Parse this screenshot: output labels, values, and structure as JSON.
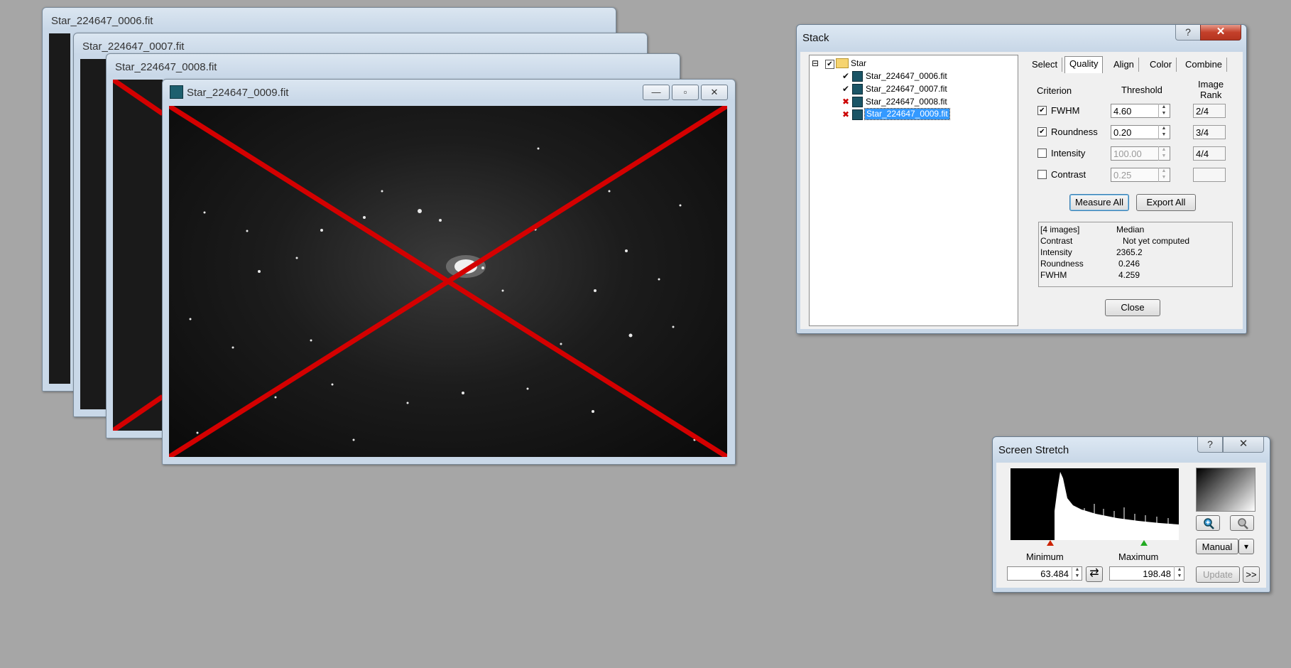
{
  "image_windows": [
    {
      "title": "Star_224647_0006.fit"
    },
    {
      "title": "Star_224647_0007.fit"
    },
    {
      "title": "Star_224647_0008.fit"
    },
    {
      "title": "Star_224647_0009.fit"
    }
  ],
  "window_buttons": {
    "minimize": "—",
    "maximize": "▫",
    "close": "✕"
  },
  "stack": {
    "title": "Stack",
    "help": "?",
    "close_glyph": "✕",
    "tree": {
      "root_label": "Star",
      "expander": "⊟",
      "items": [
        {
          "label": "Star_224647_0006.fit",
          "state": "✔"
        },
        {
          "label": "Star_224647_0007.fit",
          "state": "✔"
        },
        {
          "label": "Star_224647_0008.fit",
          "state": "✖"
        },
        {
          "label": "Star_224647_0009.fit",
          "state": "✖"
        }
      ]
    },
    "tabs": [
      "Select",
      "Quality",
      "Align",
      "Color",
      "Combine"
    ],
    "headers": {
      "criterion": "Criterion",
      "threshold": "Threshold",
      "rank_line1": "Image",
      "rank_line2": "Rank"
    },
    "criteria": [
      {
        "name": "FWHM",
        "check": "✔",
        "value": "4.60",
        "rank": "2/4"
      },
      {
        "name": "Roundness",
        "check": "✔",
        "value": "0.20",
        "rank": "3/4"
      },
      {
        "name": "Intensity",
        "check": "",
        "value": "100.00",
        "rank": "4/4"
      },
      {
        "name": "Contrast",
        "check": "",
        "value": "0.25",
        "rank": ""
      }
    ],
    "measure_all": "Measure All",
    "export_all": "Export All",
    "stats": {
      "header_left": "[4 images]",
      "header_right": "Median",
      "rows": [
        {
          "label": "Contrast",
          "value": "Not yet computed"
        },
        {
          "label": "Intensity",
          "value": "2365.2"
        },
        {
          "label": "Roundness",
          "value": "0.246"
        },
        {
          "label": "FWHM",
          "value": "4.259"
        }
      ]
    },
    "close_button": "Close"
  },
  "stretch": {
    "title": "Screen Stretch",
    "help": "?",
    "close_glyph": "✕",
    "minimum_label": "Minimum",
    "maximum_label": "Maximum",
    "min_value": "63.484",
    "max_value": "198.48",
    "swap_glyph": "⇄",
    "mode": "Manual",
    "dropdown_glyph": "▾",
    "update": "Update",
    "more": ">>"
  }
}
